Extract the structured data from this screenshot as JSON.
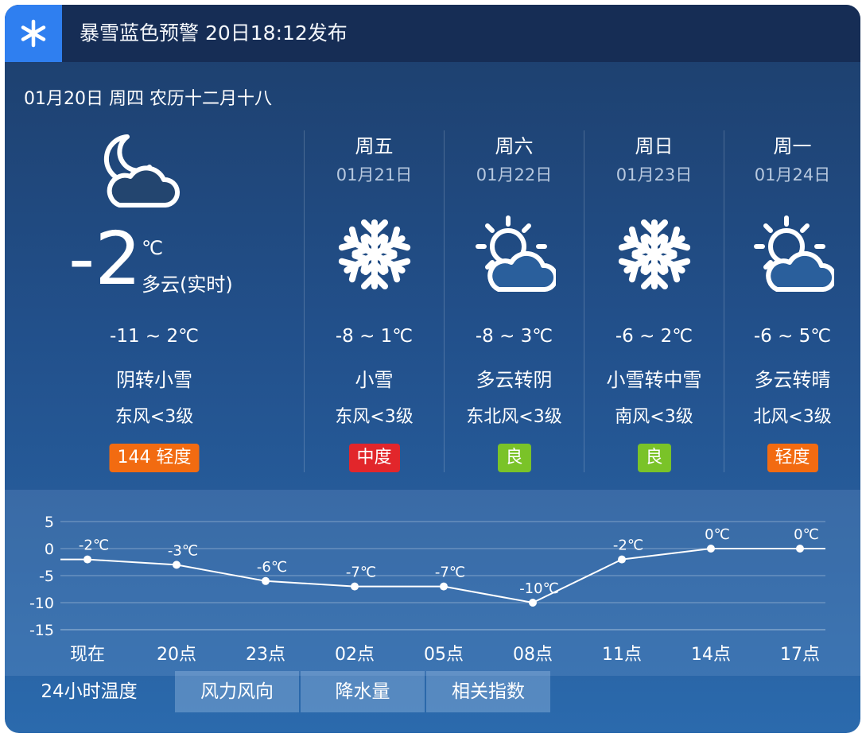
{
  "alert": {
    "text": "暴雪蓝色预警 20日18:12发布",
    "icon": "snowflake-icon"
  },
  "date_line": "01月20日 周四 农历十二月十八",
  "current": {
    "icon": "moon-cloud-icon",
    "temp": "-2",
    "unit": "℃",
    "cond": "多云(实时)",
    "range": "-11 ~ 2℃",
    "weather": "阴转小雪",
    "wind": "东风<3级",
    "aqi": "144 轻度",
    "aqi_color": "#f26b11"
  },
  "days": [
    {
      "name": "周五",
      "date": "01月21日",
      "icon": "snowflake-icon",
      "range": "-8 ~ 1℃",
      "weather": "小雪",
      "wind": "东风<3级",
      "aqi": "中度",
      "aqi_color": "#e2262b"
    },
    {
      "name": "周六",
      "date": "01月22日",
      "icon": "sun-cloud-icon",
      "range": "-8 ~ 3℃",
      "weather": "多云转阴",
      "wind": "东北风<3级",
      "aqi": "良",
      "aqi_color": "#7ac328"
    },
    {
      "name": "周日",
      "date": "01月23日",
      "icon": "snowflake-icon",
      "range": "-6 ~ 2℃",
      "weather": "小雪转中雪",
      "wind": "南风<3级",
      "aqi": "良",
      "aqi_color": "#7ac328"
    },
    {
      "name": "周一",
      "date": "01月24日",
      "icon": "sun-cloud-icon",
      "range": "-6 ~ 5℃",
      "weather": "多云转晴",
      "wind": "北风<3级",
      "aqi": "轻度",
      "aqi_color": "#f26b11"
    }
  ],
  "chart_data": {
    "type": "line",
    "categories": [
      "现在",
      "20点",
      "23点",
      "02点",
      "05点",
      "08点",
      "11点",
      "14点",
      "17点"
    ],
    "values": [
      -2,
      -3,
      -6,
      -7,
      -7,
      -10,
      -2,
      0,
      0
    ],
    "labels": [
      "-2℃",
      "-3℃",
      "-6℃",
      "-7℃",
      "-7℃",
      "-10℃",
      "-2℃",
      "0℃",
      "0℃"
    ],
    "yticks": [
      "5",
      "0",
      "-5",
      "-10",
      "-15"
    ],
    "ylim": [
      -15,
      5
    ],
    "grid": true
  },
  "tabs": [
    {
      "label": "24小时温度",
      "active": true
    },
    {
      "label": "风力风向",
      "active": false
    },
    {
      "label": "降水量",
      "active": false
    },
    {
      "label": "相关指数",
      "active": false
    }
  ]
}
